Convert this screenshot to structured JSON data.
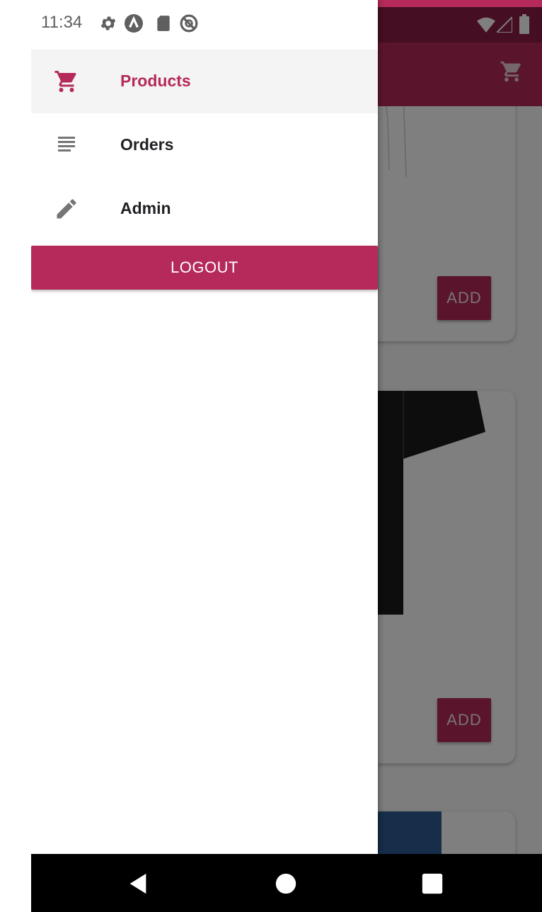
{
  "status_bar": {
    "time": "11:34"
  },
  "drawer": {
    "items": [
      {
        "label": "Products",
        "icon": "cart-icon",
        "active": true
      },
      {
        "label": "Orders",
        "icon": "list-icon",
        "active": false
      },
      {
        "label": "Admin",
        "icon": "pencil-icon",
        "active": false
      }
    ],
    "logout_label": "LOGOUT"
  },
  "app": {
    "cart_icon": "cart-icon",
    "cards": [
      {
        "add_label": "ADD"
      },
      {
        "add_label": "ADD"
      }
    ]
  },
  "navigation_bar": {
    "back_icon": "back-icon",
    "home_icon": "home-icon",
    "recents_icon": "recents-icon"
  },
  "colors": {
    "accent": "#b52a5b",
    "app_bar": "#b52a5b",
    "scrim": "rgba(0,0,0,0.5)"
  }
}
